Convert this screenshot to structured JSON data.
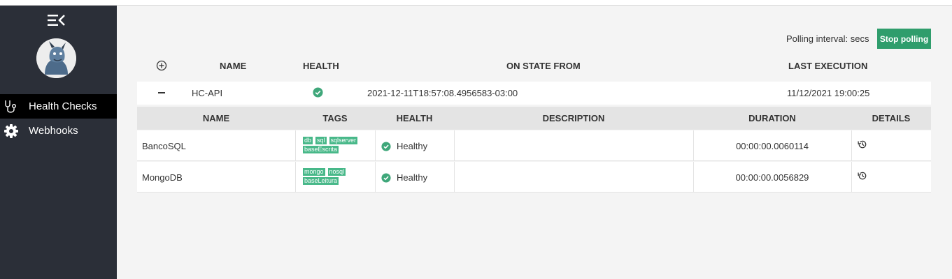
{
  "sidebar": {
    "menu_icon": "menu-collapse-icon",
    "avatar_icon": "logo-avatar",
    "items": [
      {
        "label": "Health Checks",
        "icon": "stethoscope-icon",
        "active": true
      },
      {
        "label": "Webhooks",
        "icon": "gear-icon",
        "active": false
      }
    ]
  },
  "toolbar": {
    "polling_label": "Polling interval: secs",
    "stop_label": "Stop polling"
  },
  "main_table": {
    "headers": {
      "name": "NAME",
      "health": "HEALTH",
      "on_state_from": "ON STATE FROM",
      "last_execution": "LAST EXECUTION"
    },
    "rows": [
      {
        "name": "HC-API",
        "health_icon": "check-circle-icon",
        "on_state_from": "2021-12-11T18:57:08.4956583-03:00",
        "last_execution": "11/12/2021 19:00:25"
      }
    ]
  },
  "sub_table": {
    "headers": {
      "name": "NAME",
      "tags": "TAGS",
      "health": "HEALTH",
      "description": "DESCRIPTION",
      "duration": "DURATION",
      "details": "DETAILS"
    },
    "rows": [
      {
        "name": "BancoSQL",
        "tags": [
          "db",
          "sql",
          "sqlserver",
          "baseEscrita"
        ],
        "health": "Healthy",
        "description": "",
        "duration": "00:00:00.0060114"
      },
      {
        "name": "MongoDB",
        "tags": [
          "mongo",
          "nosql",
          "baseLeitura"
        ],
        "health": "Healthy",
        "description": "",
        "duration": "00:00:00.0056829"
      }
    ]
  },
  "colors": {
    "sidebar": "#2b2f38",
    "accent": "#2f9d6c",
    "tag": "#48b889",
    "healthy": "#3fa77a"
  }
}
